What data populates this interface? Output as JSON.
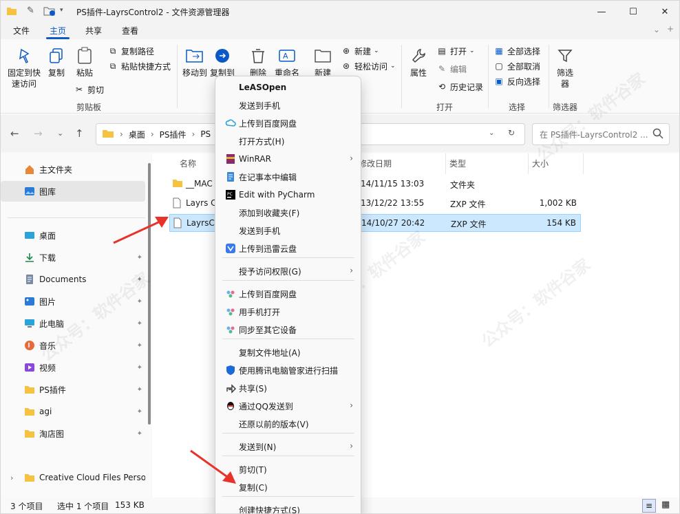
{
  "window": {
    "title": "PS插件-LayrsControl2 - 文件资源管理器",
    "minimize": "—",
    "maximize": "☐",
    "close": "✕"
  },
  "menu": {
    "items": [
      "文件",
      "主页",
      "共享",
      "查看"
    ],
    "active": "主页"
  },
  "ribbon": {
    "pin_label": "固定到快\n速访问",
    "copy_label": "复制",
    "paste_label": "粘贴",
    "copy_path": "复制路径",
    "paste_shortcut": "粘贴快捷方式",
    "cut": "剪切",
    "clipboard_group": "剪贴板",
    "move_to": "移动到",
    "copy_to": "复制到",
    "delete": "删除",
    "rename": "重命名",
    "new_folder": "新建",
    "new": "新建",
    "easy_access": "轻松访问",
    "properties": "属性",
    "open": "打开",
    "edit": "编辑",
    "history": "历史记录",
    "open_group": "打开",
    "select_all": "全部选择",
    "select_none": "全部取消",
    "invert": "反向选择",
    "select_group": "选择",
    "filter": "筛选\n器",
    "filter_group": "筛选器"
  },
  "address": {
    "crumbs": [
      "桌面",
      "PS插件",
      "PS"
    ],
    "search_placeholder": "在 PS插件-LayrsControl2 ..."
  },
  "sidebar": {
    "items": [
      {
        "label": "主文件夹",
        "icon": "home-icon"
      },
      {
        "label": "图库",
        "icon": "gallery-icon"
      },
      {
        "label": "桌面",
        "icon": "desktop-icon"
      },
      {
        "label": "下载",
        "icon": "download-icon"
      },
      {
        "label": "Documents",
        "icon": "documents-icon"
      },
      {
        "label": "图片",
        "icon": "pictures-icon"
      },
      {
        "label": "此电脑",
        "icon": "pc-icon"
      },
      {
        "label": "音乐",
        "icon": "music-icon"
      },
      {
        "label": "视频",
        "icon": "video-icon"
      },
      {
        "label": "PS插件",
        "icon": "folder-icon"
      },
      {
        "label": "agi",
        "icon": "folder-icon"
      },
      {
        "label": "淘店图",
        "icon": "folder-icon"
      },
      {
        "label": "Creative Cloud Files Person",
        "icon": "folder-icon"
      }
    ],
    "pin": "📌"
  },
  "files": {
    "columns": [
      "名称",
      "修改日期",
      "类型",
      "大小"
    ],
    "rows": [
      {
        "name": "__MAC",
        "date": "14/11/15 13:03",
        "type": "文件夹",
        "size": ""
      },
      {
        "name": "Layrs C",
        "date": "13/12/22 13:55",
        "type": "ZXP 文件",
        "size": "1,002 KB"
      },
      {
        "name": "LayrsCo",
        "date": "14/10/27 20:42",
        "type": "ZXP 文件",
        "size": "154 KB"
      }
    ]
  },
  "status": {
    "count": "3 个项目",
    "selected": "选中 1 个项目",
    "size": "153 KB"
  },
  "context_menu": {
    "items": [
      {
        "label": "LeASOpen",
        "bold": true
      },
      {
        "label": "发送到手机"
      },
      {
        "label": "上传到百度网盘",
        "icon": "baidu-cloud-icon"
      },
      {
        "label": "打开方式(H)"
      },
      {
        "label": "WinRAR",
        "icon": "winrar-icon",
        "submenu": true
      },
      {
        "label": "在记事本中编辑",
        "icon": "notepad-icon"
      },
      {
        "label": "Edit with PyCharm",
        "icon": "pycharm-icon"
      },
      {
        "label": "添加到收藏夹(F)"
      },
      {
        "label": "发送到手机"
      },
      {
        "label": "上传到迅雷云盘",
        "icon": "xunlei-icon"
      },
      {
        "label": "授予访问权限(G)",
        "submenu": true
      },
      {
        "label": "上传到百度网盘",
        "icon": "baidu-icon"
      },
      {
        "label": "用手机打开",
        "icon": "baidu-icon"
      },
      {
        "label": "同步至其它设备",
        "icon": "baidu-icon"
      },
      {
        "label": "复制文件地址(A)"
      },
      {
        "label": "使用腾讯电脑管家进行扫描",
        "icon": "tencent-shield-icon"
      },
      {
        "label": "共享(S)",
        "icon": "share-icon"
      },
      {
        "label": "通过QQ发送到",
        "icon": "qq-icon",
        "submenu": true
      },
      {
        "label": "还原以前的版本(V)"
      },
      {
        "label": "发送到(N)",
        "submenu": true
      },
      {
        "label": "剪切(T)"
      },
      {
        "label": "复制(C)"
      },
      {
        "label": "创建快捷方式(S)"
      }
    ],
    "arrow": "›"
  },
  "watermark": "公众号：软件谷家",
  "colors": {
    "accent": "#0b58c6",
    "arrow": "#e8332a",
    "folder": "#f5c242"
  }
}
